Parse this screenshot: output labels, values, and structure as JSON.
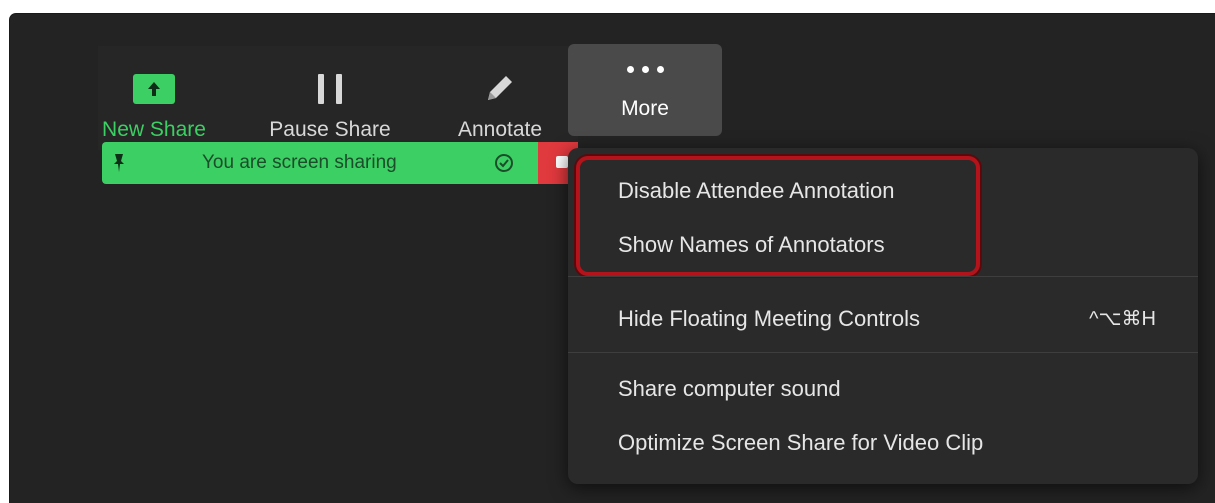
{
  "toolbar": {
    "new_share_label": "New Share",
    "pause_share_label": "Pause Share",
    "annotate_label": "Annotate",
    "more_label": "More"
  },
  "sharing_bar": {
    "status_text": "You are screen sharing"
  },
  "menu": {
    "items": [
      {
        "label": "Disable Attendee Annotation"
      },
      {
        "label": "Show Names of Annotators"
      },
      {
        "label": "Hide Floating Meeting Controls",
        "shortcut": "^⌥⌘H"
      },
      {
        "label": "Share computer sound"
      },
      {
        "label": "Optimize Screen Share for Video Clip"
      }
    ]
  },
  "colors": {
    "background": "#232323",
    "accent_green": "#3ccf63",
    "stop_red": "#e0393e",
    "highlight_red": "#b3131a",
    "menu_bg": "#2a2a2a"
  },
  "icons": [
    "upload-arrow-icon",
    "pause-icon",
    "pencil-icon",
    "more-dots-icon",
    "pin-icon",
    "check-circle-icon",
    "stop-icon"
  ]
}
